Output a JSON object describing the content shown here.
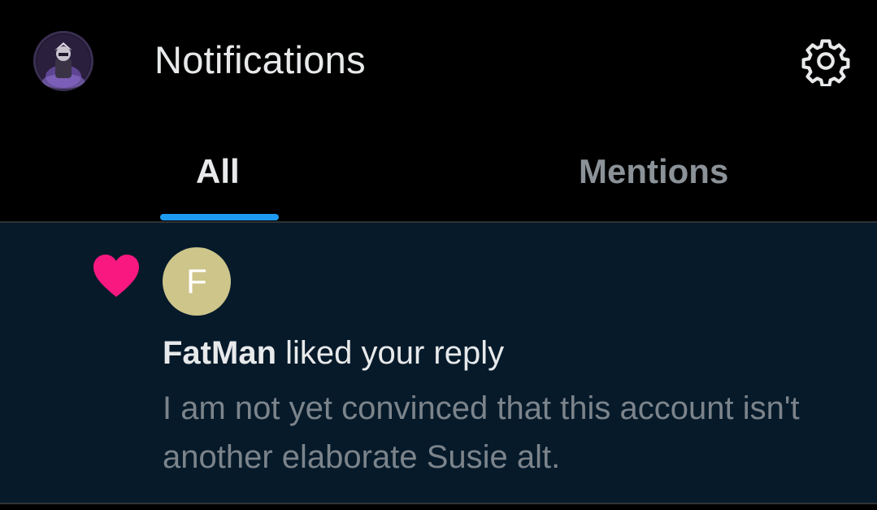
{
  "header": {
    "title": "Notifications",
    "avatar_icon": "profile-avatar-icon",
    "settings_icon": "gear-icon"
  },
  "tabs": [
    {
      "label": "All",
      "selected": true
    },
    {
      "label": "Mentions",
      "selected": false
    }
  ],
  "notifications": [
    {
      "type_icon": "heart-icon",
      "avatar_letter": "F",
      "user": "FatMan",
      "action": " liked your reply",
      "snippet": "I am not yet convinced that this account isn't another elaborate Susie alt."
    }
  ],
  "colors": {
    "background": "#000000",
    "notification_background": "#061a2a",
    "accent": "#1d9bf0",
    "like": "#f91880",
    "avatar_bg": "#cdc58a",
    "text_primary": "#e7e9ea",
    "text_secondary": "#7c848b"
  }
}
